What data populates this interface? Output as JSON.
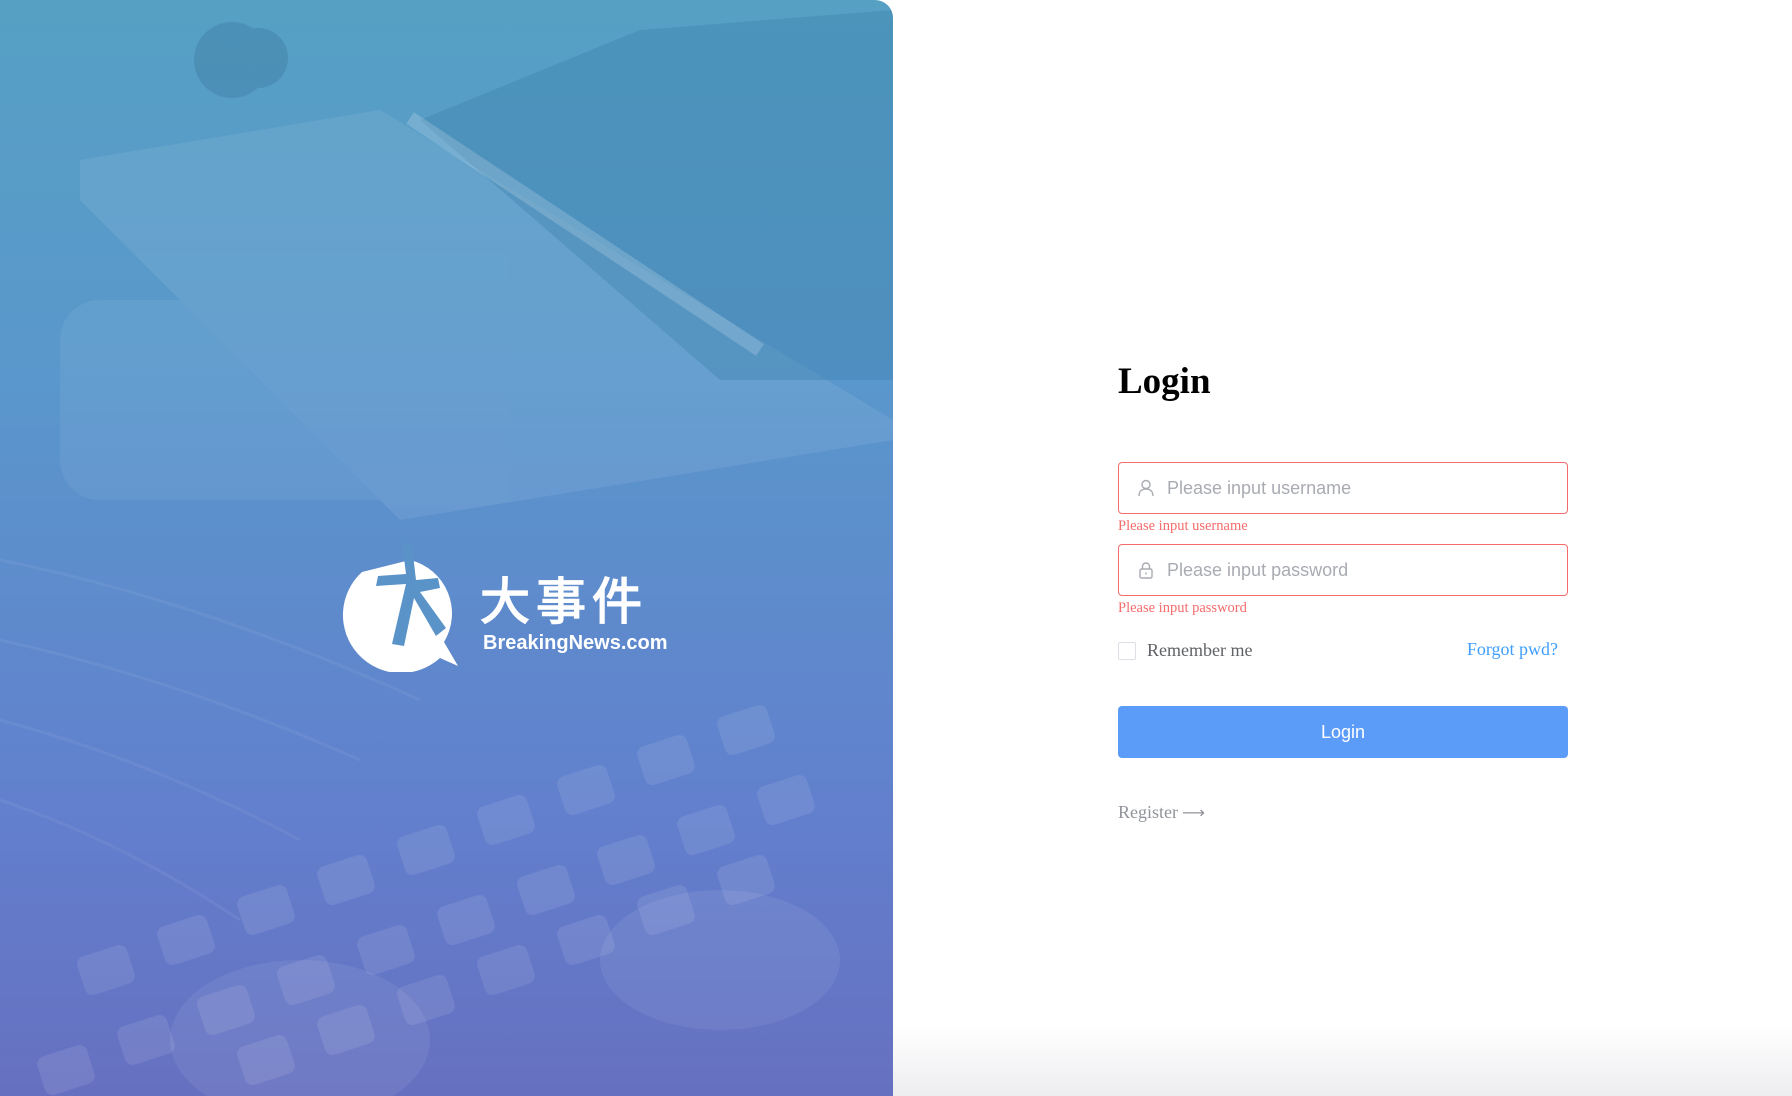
{
  "hero": {
    "logo_cn": "大事件",
    "logo_en": "BreakingNews.com"
  },
  "form": {
    "title": "Login",
    "username": {
      "placeholder": "Please input username",
      "value": "",
      "error": "Please input username",
      "icon": "user-icon"
    },
    "password": {
      "placeholder": "Please input password",
      "value": "",
      "error": "Please input password",
      "icon": "lock-icon"
    },
    "remember_label": "Remember me",
    "remember_checked": false,
    "forgot_label": "Forgot pwd?",
    "login_label": "Login",
    "register_label": "Register"
  },
  "colors": {
    "accent": "#5b9cf8",
    "link": "#409eff",
    "error": "#f56c6c"
  }
}
